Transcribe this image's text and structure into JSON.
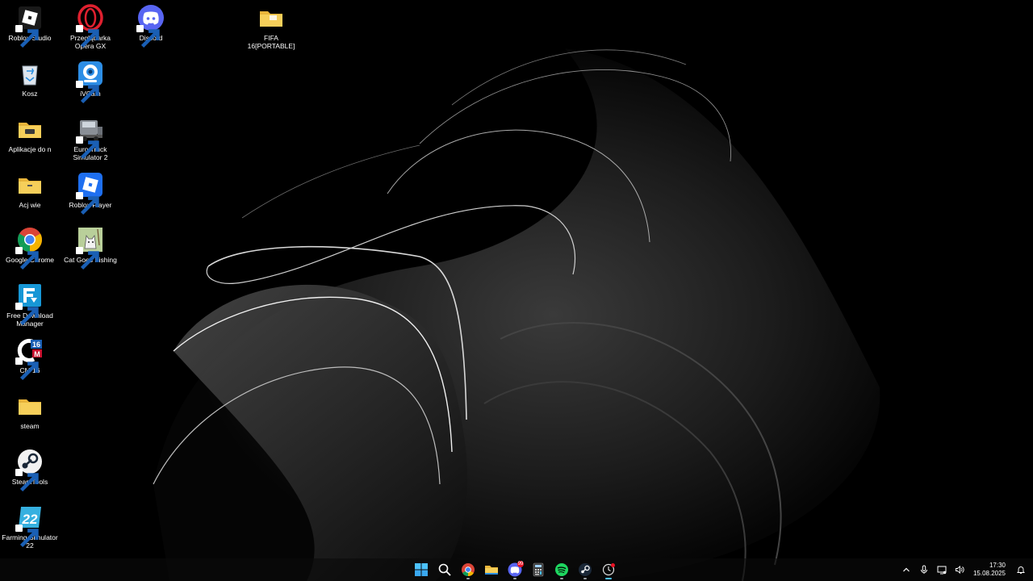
{
  "desktop": {
    "icons": [
      {
        "label": "Roblox Studio",
        "icon": "roblox-studio-icon"
      },
      {
        "label": "Przeglądarka Opera GX",
        "icon": "opera-gx-icon"
      },
      {
        "label": "Discord",
        "icon": "discord-icon"
      },
      {
        "label": "FIFA 16[PORTABLE]",
        "icon": "folder-icon"
      },
      {
        "label": "Kosz",
        "icon": "recycle-bin-icon"
      },
      {
        "label": "iVCam",
        "icon": "ivcam-icon"
      },
      {
        "label": "Aplikacje do n",
        "icon": "folder-icon"
      },
      {
        "label": "Euro Truck Simulator 2",
        "icon": "euro-truck-simulator-icon"
      },
      {
        "label": "Acj wie",
        "icon": "folder-icon"
      },
      {
        "label": "Roblox Player",
        "icon": "roblox-player-icon"
      },
      {
        "label": "Google Chrome",
        "icon": "chrome-icon"
      },
      {
        "label": "Cat Goes Fishing",
        "icon": "cat-goes-fishing-icon"
      },
      {
        "label": "Free Download Manager",
        "icon": "free-download-manager-icon"
      },
      {
        "label": "CM 16",
        "icon": "cm16-icon"
      },
      {
        "label": "steam",
        "icon": "folder-icon"
      },
      {
        "label": "SteamTools",
        "icon": "steamtools-icon"
      },
      {
        "label": "Farming Simulator 22",
        "icon": "farming-simulator-icon"
      }
    ]
  },
  "taskbar": {
    "apps": [
      "start-icon",
      "search-icon",
      "chrome-icon",
      "file-explorer-icon",
      "discord-icon",
      "calculator-icon",
      "spotify-icon",
      "steam-icon",
      "clock-app-icon"
    ],
    "discord_badge": "99",
    "tray": [
      "chevron-up-icon",
      "microphone-icon",
      "network-icon",
      "volume-icon"
    ],
    "time": "17:30",
    "date": "15.08.2025"
  },
  "colors": {
    "background": "#000000",
    "folder": "#f4c842",
    "discord": "#5865f2",
    "roblox_player": "#1e6ff0",
    "spotify": "#1ed760",
    "steam": "#1b2838"
  }
}
